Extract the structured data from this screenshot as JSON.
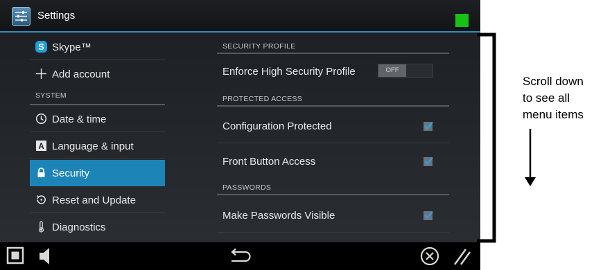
{
  "app": {
    "title": "Settings",
    "status_color": "#15c215",
    "accent_color": "#1d84b8"
  },
  "sidebar": {
    "items": [
      {
        "label": "Skype™",
        "icon": "skype-icon"
      },
      {
        "label": "Add account",
        "icon": "plus-icon"
      },
      {
        "section": "SYSTEM"
      },
      {
        "label": "Date & time",
        "icon": "clock-icon"
      },
      {
        "label": "Language & input",
        "icon": "keyboard-a-icon"
      },
      {
        "label": "Security",
        "icon": "lock-icon",
        "selected": true
      },
      {
        "label": "Reset and Update",
        "icon": "restore-icon"
      },
      {
        "label": "Diagnostics",
        "icon": "thermometer-icon"
      }
    ]
  },
  "panel": {
    "sections": [
      {
        "header": "SECURITY PROFILE",
        "rows": [
          {
            "label": "Enforce High Security Profile",
            "control": "toggle",
            "value": "OFF"
          }
        ]
      },
      {
        "header": "PROTECTED ACCESS",
        "rows": [
          {
            "label": "Configuration Protected",
            "control": "checkbox",
            "checked": true
          },
          {
            "label": "Front Button Access",
            "control": "checkbox",
            "checked": true
          }
        ]
      },
      {
        "header": "PASSWORDS",
        "rows": [
          {
            "label": "Make Passwords Visible",
            "control": "checkbox",
            "checked": true
          }
        ]
      }
    ]
  },
  "navbar": {
    "buttons": [
      "square-icon",
      "speaker-icon",
      "back-icon",
      "close-circle-icon",
      "resize-grip-icon"
    ]
  },
  "annotation": {
    "lines": [
      "Scroll down",
      "to see all",
      "menu items"
    ]
  }
}
